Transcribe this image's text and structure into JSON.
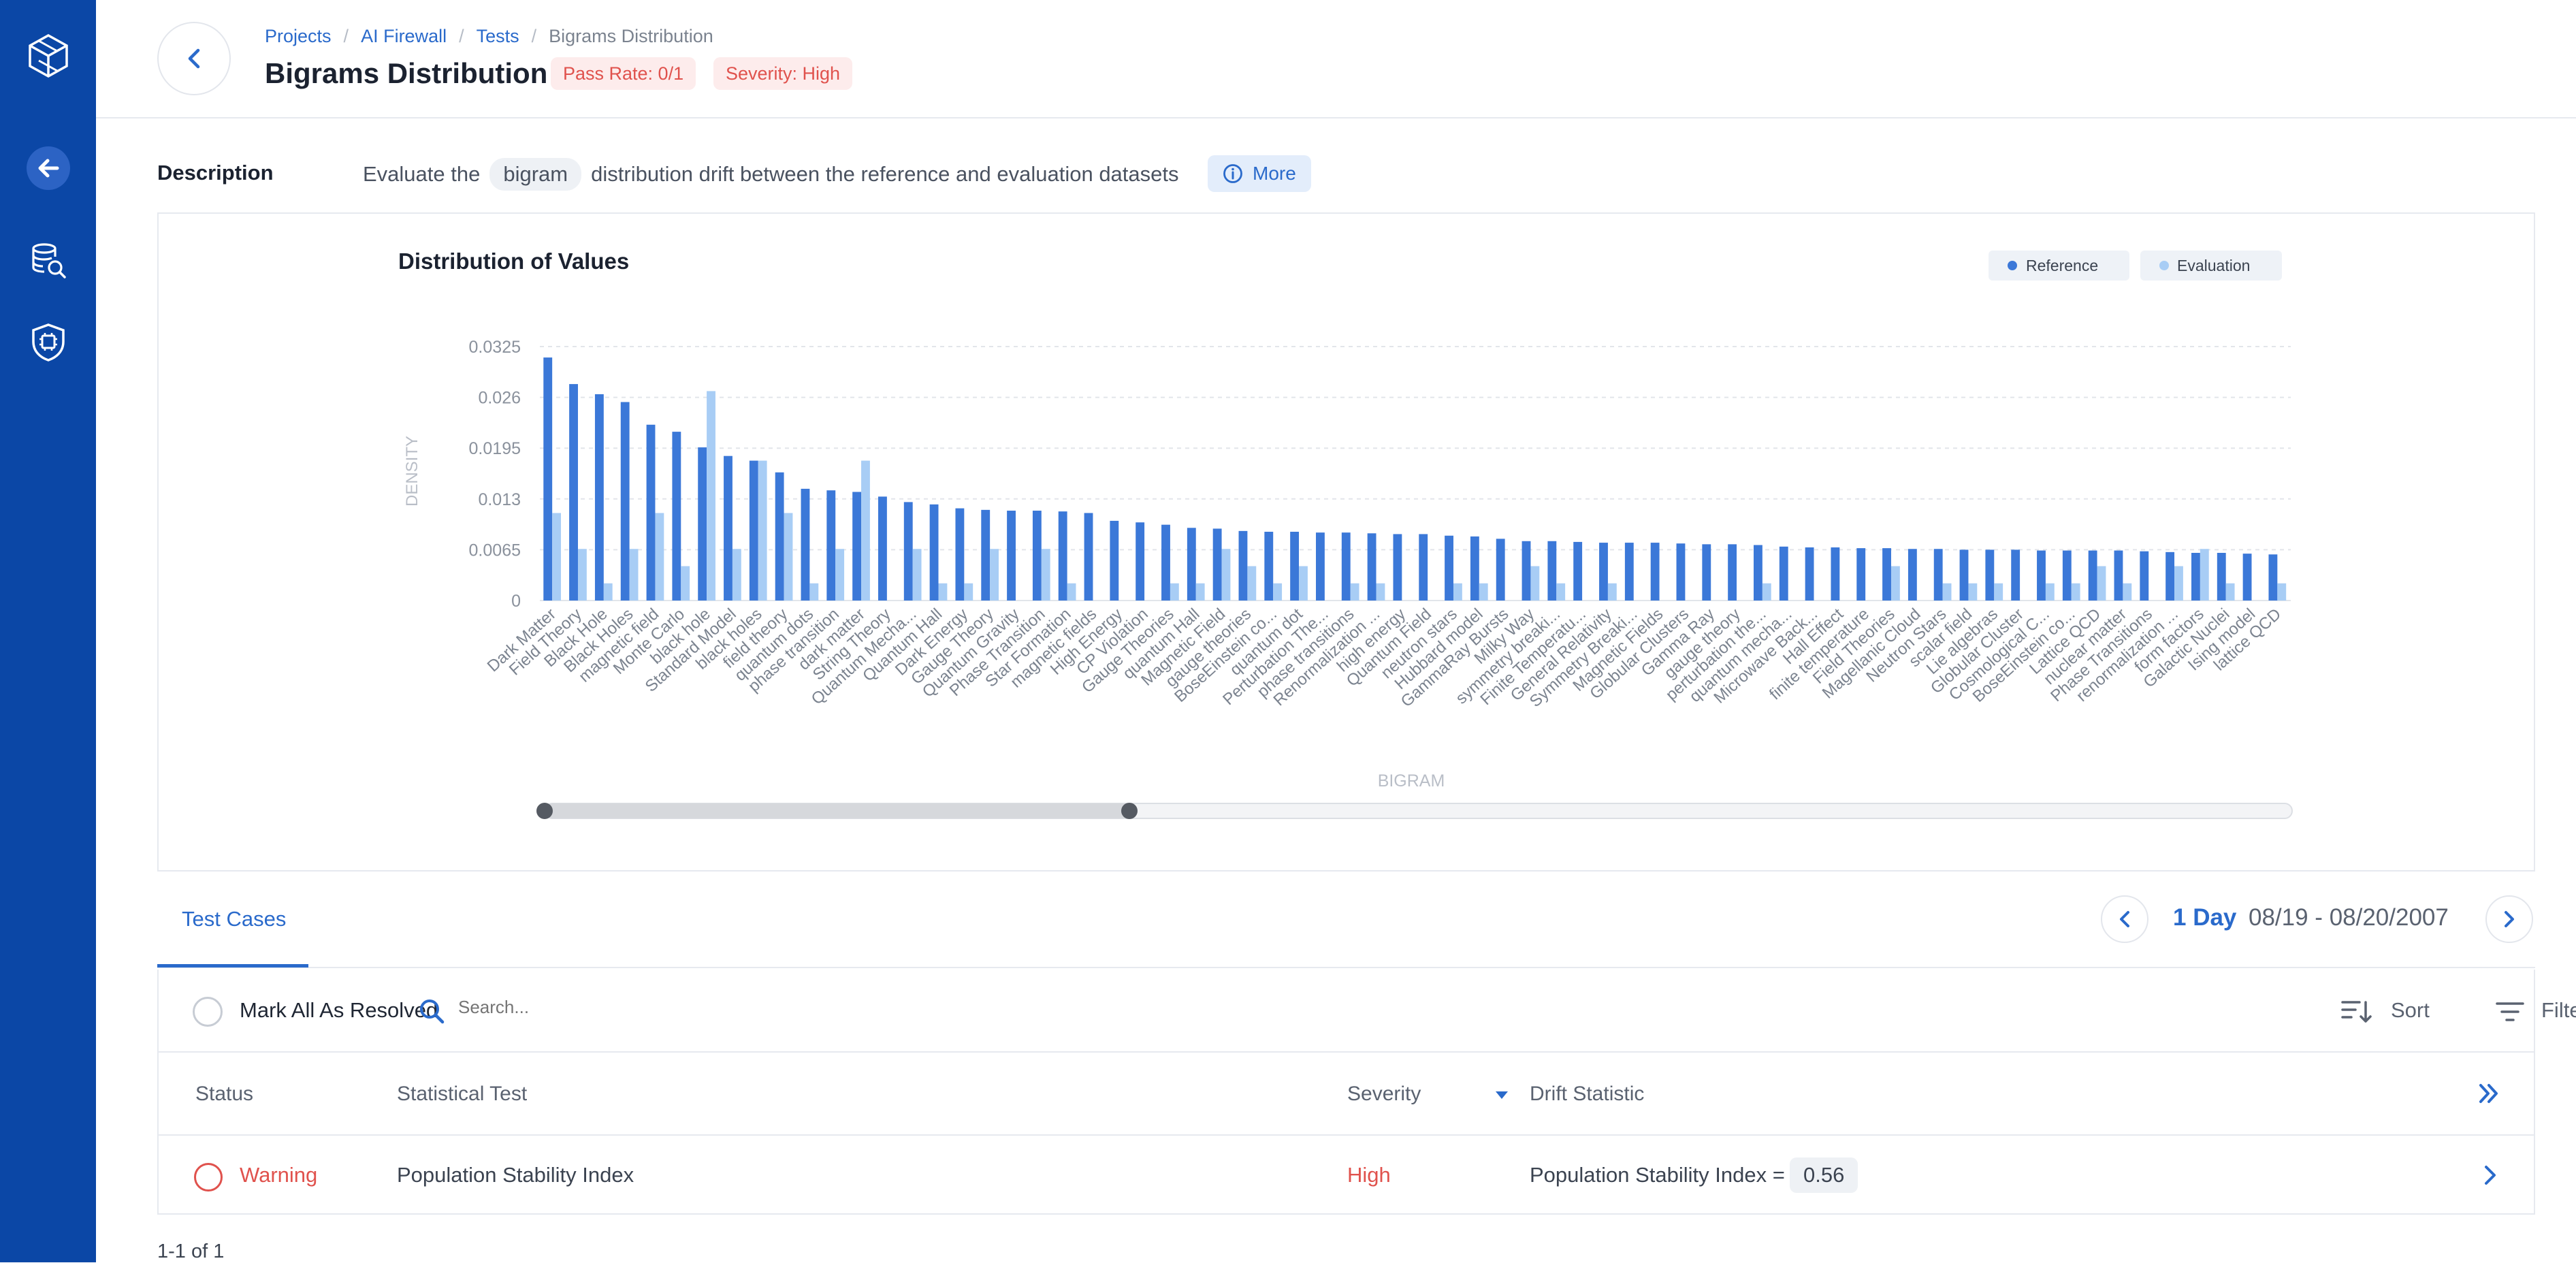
{
  "nav": {
    "logo_icon": "cube-logo-icon",
    "items": [
      {
        "icon": "arrow-left-icon"
      },
      {
        "icon": "database-search-icon"
      },
      {
        "icon": "shield-chip-icon"
      }
    ]
  },
  "header": {
    "breadcrumbs": [
      "Projects",
      "AI Firewall",
      "Tests",
      "Bigrams Distribution"
    ],
    "title": "Bigrams Distribution",
    "pass_rate": "Pass Rate: 0/1",
    "severity": "Severity: High"
  },
  "description": {
    "label": "Description",
    "text_before": "Evaluate the",
    "chip": "bigram",
    "text_after": "distribution drift between the reference and evaluation datasets",
    "more_label": "More"
  },
  "colors": {
    "reference": "#3b78d8",
    "evaluation": "#a8cdf5",
    "accent": "#2a6acb",
    "danger": "#e0524d",
    "rail": "#0b47a6"
  },
  "chart_data": {
    "type": "bar",
    "title": "Distribution of Values",
    "xlabel": "BIGRAM",
    "ylabel": "DENSITY",
    "ylim": [
      0,
      0.0325
    ],
    "yticks": [
      "0",
      "0.0065",
      "0.013",
      "0.0195",
      "0.026",
      "0.0325"
    ],
    "grid": "horizontal dashed",
    "legend_position": "top-right",
    "categories": [
      "Dark Matter",
      "Field Theory",
      "Black Hole",
      "Black Holes",
      "magnetic field",
      "Monte Carlo",
      "black hole",
      "Standard Model",
      "black holes",
      "field theory",
      "quantum dots",
      "phase transition",
      "dark matter",
      "String Theory",
      "Quantum Mecha...",
      "Quantum Hall",
      "Dark Energy",
      "Gauge Theory",
      "Quantum Gravity",
      "Phase Transition",
      "Star Formation",
      "magnetic fields",
      "High Energy",
      "CP Violation",
      "Gauge Theories",
      "quantum Hall",
      "Magnetic Field",
      "gauge theories",
      "BoseEinstein co...",
      "quantum dot",
      "Perturbation The...",
      "phase transitions",
      "Renormalization ...",
      "high energy",
      "Quantum Field",
      "neutron stars",
      "Hubbard model",
      "GammaRay Bursts",
      "Milky Way",
      "symmetry breaki...",
      "Finite Temperatu...",
      "General Relativity",
      "Symmetry Breaki...",
      "Magnetic Fields",
      "Globular Clusters",
      "Gamma Ray",
      "gauge theory",
      "perturbation the...",
      "quantum mecha...",
      "Microwave Back...",
      "Hall Effect",
      "finite temperature",
      "Field Theories",
      "Magellanic Cloud",
      "Neutron Stars",
      "scalar field",
      "Lie algebras",
      "Globular Cluster",
      "Cosmological C...",
      "BoseEinstein co...",
      "Lattice QCD",
      "nuclear matter",
      "Phase Transitions",
      "renormalization ...",
      "form factors",
      "Galactic Nuclei",
      "Ising model",
      "lattice QCD"
    ],
    "series": [
      {
        "name": "Reference",
        "values": [
          0.0311,
          0.0277,
          0.0264,
          0.0254,
          0.0225,
          0.0216,
          0.0196,
          0.0185,
          0.0179,
          0.0164,
          0.0143,
          0.0141,
          0.0139,
          0.0133,
          0.0126,
          0.0123,
          0.0118,
          0.0116,
          0.0115,
          0.0115,
          0.0114,
          0.0112,
          0.0102,
          0.01,
          0.0097,
          0.0093,
          0.0092,
          0.0089,
          0.0088,
          0.0088,
          0.0087,
          0.0087,
          0.0086,
          0.0085,
          0.0085,
          0.0083,
          0.0082,
          0.0079,
          0.0076,
          0.0076,
          0.0075,
          0.0074,
          0.0074,
          0.0074,
          0.0073,
          0.0072,
          0.0072,
          0.0071,
          0.0069,
          0.0068,
          0.0068,
          0.0067,
          0.0067,
          0.0066,
          0.0066,
          0.0065,
          0.0065,
          0.0065,
          0.0064,
          0.0064,
          0.0064,
          0.0064,
          0.0063,
          0.0062,
          0.0061,
          0.0061,
          0.006,
          0.0059
        ]
      },
      {
        "name": "Evaluation",
        "values": [
          0.0112,
          0.0066,
          0.0022,
          0.0066,
          0.0112,
          0.0044,
          0.0268,
          0.0066,
          0.0179,
          0.0112,
          0.0022,
          0.0066,
          0.0179,
          0,
          0.0066,
          0.0022,
          0.0022,
          0.0066,
          0,
          0.0066,
          0.0022,
          0,
          0,
          0,
          0.0022,
          0.0022,
          0.0066,
          0.0044,
          0.0022,
          0.0044,
          0,
          0.0022,
          0.0022,
          0,
          0,
          0.0022,
          0.0022,
          0,
          0.0044,
          0.0022,
          0,
          0.0022,
          0,
          0,
          0,
          0,
          0,
          0.0022,
          0,
          0,
          0,
          0,
          0.0044,
          0,
          0.0022,
          0.0022,
          0.0022,
          0,
          0.0022,
          0.0022,
          0.0044,
          0.0022,
          0,
          0.0044,
          0.0066,
          0.0022,
          0,
          0.0022
        ]
      }
    ]
  },
  "tabs": {
    "active": "Test Cases"
  },
  "date_nav": {
    "span": "1 Day",
    "range": "08/19 - 08/20/2007"
  },
  "toolbar": {
    "mark_all": "Mark All As Resolved",
    "search_placeholder": "Search...",
    "sort_label": "Sort",
    "filter_label": "Filter"
  },
  "table": {
    "columns": [
      "Status",
      "Statistical Test",
      "Severity",
      "Drift Statistic"
    ],
    "rows": [
      {
        "status": "Warning",
        "test": "Population Stability Index",
        "severity": "High",
        "drift_label": "Population Stability Index =",
        "drift_value": "0.56"
      }
    ]
  },
  "pagination": {
    "summary": "1-1 of 1"
  }
}
